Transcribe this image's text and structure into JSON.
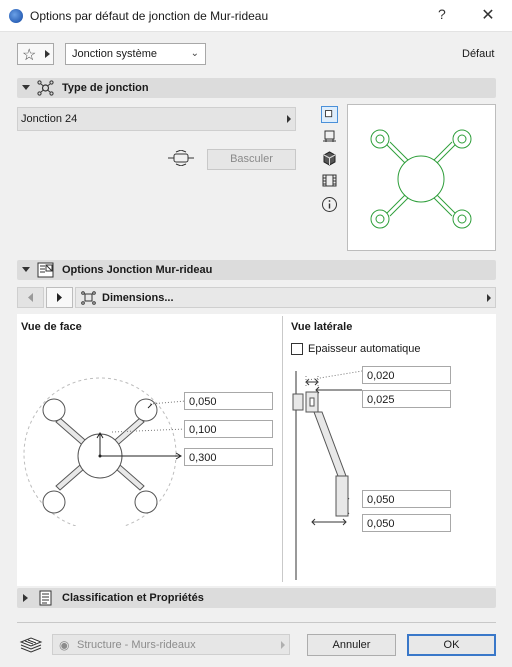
{
  "window": {
    "title": "Options par défaut de jonction de Mur-rideau",
    "help_label": "?",
    "close_label": "✕"
  },
  "toolbar": {
    "favorites_icon": "star-icon",
    "system_select_value": "Jonction système",
    "default_label": "Défaut"
  },
  "sections": {
    "type": "Type de jonction",
    "options": "Options Jonction Mur-rideau",
    "classification": "Classification et Propriétés"
  },
  "junction": {
    "value": "Jonction 24",
    "swap_button": "Basculer"
  },
  "view_tools": [
    "square-view-icon",
    "plan-view-icon",
    "3d-cube-icon",
    "film-strip-icon",
    "info-icon"
  ],
  "options_panel": {
    "tab_label": "Dimensions...",
    "front_view_label": "Vue de face",
    "side_view_label": "Vue latérale",
    "auto_thickness_label": "Epaisseur automatique",
    "front_fields": [
      "0,050",
      "0,100",
      "0,300"
    ],
    "side_fields": [
      "0,020",
      "0,025",
      "0,050",
      "0,050"
    ]
  },
  "footer": {
    "layer_value": "Structure - Murs-rideaux",
    "cancel_label": "Annuler",
    "ok_label": "OK"
  },
  "colors": {
    "preview_stroke": "#2e9e3a",
    "accent": "#3a78c9",
    "section_bg": "#dcdcdc"
  }
}
